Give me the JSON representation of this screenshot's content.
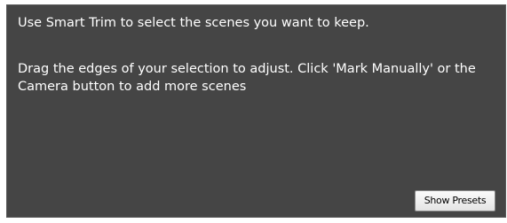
{
  "panel": {
    "instruction_line1": "Use Smart Trim to select the scenes you want to keep.",
    "instruction_line2": "Drag the edges of your selection to adjust. Click 'Mark Manually' or the Camera button to add more scenes",
    "show_presets_label": "Show Presets"
  },
  "colors": {
    "panel_background": "#454545",
    "text": "#ffffff",
    "button_background": "#f0f0f0"
  }
}
